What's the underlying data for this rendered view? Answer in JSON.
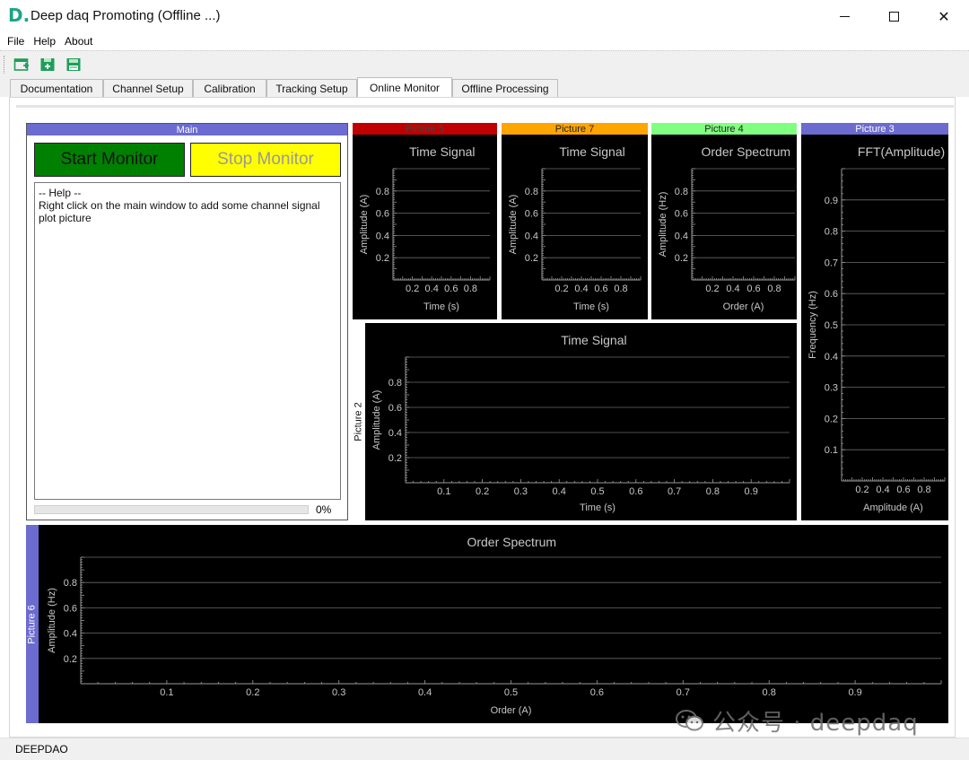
{
  "window": {
    "logo": "D.",
    "title": "Deep daq Promoting (Offline ...)",
    "minimize_icon": "minimize-icon",
    "maximize_icon": "maximize-icon",
    "close_icon": "close-icon"
  },
  "menu": [
    "File",
    "Help",
    "About"
  ],
  "toolbar": {
    "buttons": [
      "new-project-icon",
      "open-project-icon",
      "save-project-icon"
    ],
    "icon_color": "#1e9e5a"
  },
  "tabs": {
    "items": [
      "Documentation",
      "Channel Setup",
      "Calibration",
      "Tracking Setup",
      "Online Monitor",
      "Offline Processing"
    ],
    "active": "Online Monitor"
  },
  "main_panel": {
    "header": "Main",
    "header_color": "#6b6bd0",
    "start_label": "Start Monitor",
    "start_color": "#008000",
    "stop_label": "Stop Monitor",
    "stop_color": "#ffff00",
    "help_text": "-- Help --\nRight click on the main window to add some channel signal plot picture",
    "progress": 0,
    "progress_label": "0%"
  },
  "plots": {
    "picture5": {
      "tab": "Picture 5",
      "tab_color": "#c00000",
      "chart_data": {
        "type": "line",
        "title": "Time Signal",
        "xlabel": "Time (s)",
        "ylabel": "Amplitude (A)",
        "xticks": [
          "0.2",
          "0.4",
          "0.6",
          "0.8"
        ],
        "yticks": [
          "0.2",
          "0.4",
          "0.6",
          "0.8"
        ],
        "xlim": [
          0,
          1
        ],
        "ylim": [
          0,
          1
        ],
        "grid": true,
        "series": []
      }
    },
    "picture7": {
      "tab": "Picture 7",
      "tab_color": "#ffa500",
      "chart_data": {
        "type": "line",
        "title": "Time Signal",
        "xlabel": "Time (s)",
        "ylabel": "Amplitude (A)",
        "xticks": [
          "0.2",
          "0.4",
          "0.6",
          "0.8"
        ],
        "yticks": [
          "0.2",
          "0.4",
          "0.6",
          "0.8"
        ],
        "xlim": [
          0,
          1
        ],
        "ylim": [
          0,
          1
        ],
        "grid": true,
        "series": []
      }
    },
    "picture4": {
      "tab": "Picture 4",
      "tab_color": "#80ff80",
      "chart_data": {
        "type": "line",
        "title": "Order Spectrum",
        "xlabel": "Order (A)",
        "ylabel": "Amplitude (Hz)",
        "xticks": [
          "0.2",
          "0.4",
          "0.6",
          "0.8"
        ],
        "yticks": [
          "0.2",
          "0.4",
          "0.6",
          "0.8"
        ],
        "xlim": [
          0,
          1
        ],
        "ylim": [
          0,
          1
        ],
        "grid": true,
        "series": []
      }
    },
    "picture3": {
      "tab": "Picture 3",
      "tab_color": "#6b6bd0",
      "chart_data": {
        "type": "line",
        "title": "FFT(Amplitude)",
        "xlabel": "Amplitude (A)",
        "ylabel": "Frequency (Hz)",
        "xticks": [
          "0.2",
          "0.4",
          "0.6",
          "0.8"
        ],
        "yticks": [
          "0.1",
          "0.2",
          "0.3",
          "0.4",
          "0.5",
          "0.6",
          "0.7",
          "0.8",
          "0.9"
        ],
        "xlim": [
          0,
          1
        ],
        "ylim": [
          0,
          1
        ],
        "grid": true,
        "series": []
      }
    },
    "picture2": {
      "tab": "Picture 2",
      "tab_color": "#ffffff",
      "chart_data": {
        "type": "line",
        "title": "Time Signal",
        "xlabel": "Time (s)",
        "ylabel": "Amplitude (A)",
        "xticks": [
          "0.1",
          "0.2",
          "0.3",
          "0.4",
          "0.5",
          "0.6",
          "0.7",
          "0.8",
          "0.9"
        ],
        "yticks": [
          "0.2",
          "0.4",
          "0.6",
          "0.8"
        ],
        "xlim": [
          0,
          1
        ],
        "ylim": [
          0,
          1
        ],
        "grid": true,
        "series": []
      }
    },
    "picture6": {
      "tab": "Picture 6",
      "tab_color": "#6b6bd0",
      "chart_data": {
        "type": "line",
        "title": "Order Spectrum",
        "xlabel": "Order (A)",
        "ylabel": "Amplitude (Hz)",
        "xticks": [
          "0.1",
          "0.2",
          "0.3",
          "0.4",
          "0.5",
          "0.6",
          "0.7",
          "0.8",
          "0.9"
        ],
        "yticks": [
          "0.2",
          "0.4",
          "0.6",
          "0.8"
        ],
        "xlim": [
          0,
          1
        ],
        "ylim": [
          0,
          1
        ],
        "grid": true,
        "series": []
      }
    }
  },
  "status": "DEEPDAO",
  "watermark": {
    "text": "公众号 · deepdaq",
    "icon": "wechat-icon"
  }
}
